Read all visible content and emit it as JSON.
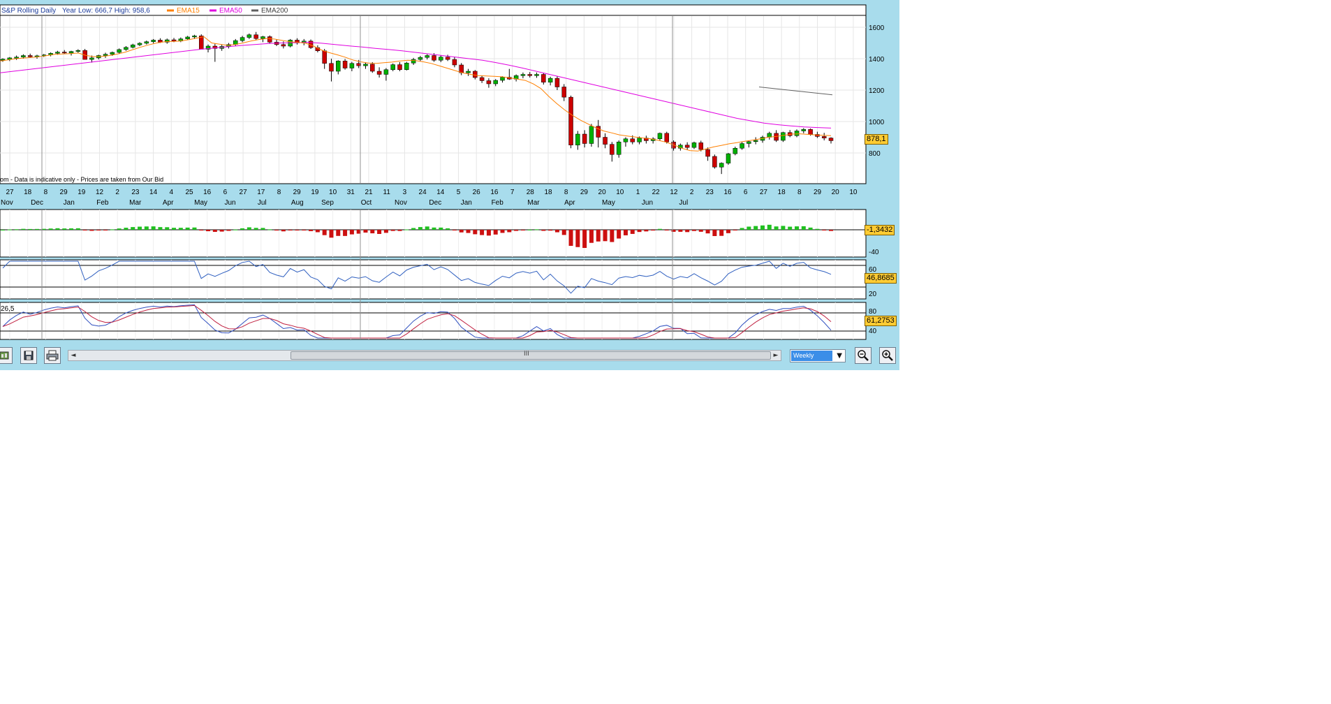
{
  "header": {
    "instrument": "S&P Rolling Daily",
    "year_range": "Year Low: 666,7 High: 958,6",
    "disclaimer": "om - Data is indicative only - Prices are taken from Our Bid"
  },
  "legend": [
    {
      "name": "EMA15",
      "color": "#ff8000"
    },
    {
      "name": "EMA50",
      "color": "#e000e0"
    },
    {
      "name": "EMA200",
      "color": "#606060"
    }
  ],
  "colors": {
    "up": "#00b000",
    "down": "#cc0000",
    "frame": "#a8dcec",
    "panel": "#ffffff",
    "grid": "#e6e6e6"
  },
  "price_axis": {
    "ticks": [
      "1600",
      "1400",
      "1200",
      "1000",
      "800"
    ]
  },
  "date_axis": {
    "days": [
      "27",
      "18",
      "8",
      "29",
      "19",
      "12",
      "2",
      "23",
      "14",
      "4",
      "25",
      "16",
      "6",
      "27",
      "17",
      "8",
      "29",
      "19",
      "10",
      "31",
      "21",
      "11",
      "3",
      "24",
      "14",
      "5",
      "26",
      "16",
      "7",
      "28",
      "18",
      "8",
      "29",
      "20",
      "10",
      "1",
      "22",
      "12",
      "2",
      "23",
      "16",
      "6",
      "27",
      "18",
      "8",
      "29",
      "20",
      "10"
    ],
    "months": [
      "Nov",
      "Dec",
      "Jan",
      "Feb",
      "Mar",
      "Apr",
      "May",
      "Jun",
      "Jul",
      "Aug",
      "Sep",
      "Oct",
      "Nov",
      "Dec",
      "Jan",
      "Feb",
      "Mar",
      "Apr",
      "May",
      "Jun",
      "Jul"
    ]
  },
  "last_values": {
    "price": "878,1",
    "histogram": "-1,3432",
    "rsi": "46,8685",
    "stoch": "61,2753"
  },
  "histogram_panel": {
    "tick": "-40"
  },
  "rsi_panel": {
    "ticks": [
      "60",
      "20"
    ]
  },
  "stoch_panel": {
    "left_label": "26,5",
    "ticks": [
      "80",
      "40"
    ]
  },
  "toolbar": {
    "period": "Weekly",
    "scroll_grip": "III",
    "scroll_left": "◄",
    "scroll_right": "►"
  },
  "chart_data": {
    "type": "line",
    "title": "S&P Rolling Daily",
    "candles": [
      {
        "o": 1390,
        "h": 1402,
        "l": 1380,
        "c": 1397
      },
      {
        "o": 1395,
        "h": 1410,
        "l": 1385,
        "c": 1405
      },
      {
        "o": 1403,
        "h": 1420,
        "l": 1392,
        "c": 1410
      },
      {
        "o": 1410,
        "h": 1428,
        "l": 1400,
        "c": 1420
      },
      {
        "o": 1420,
        "h": 1432,
        "l": 1405,
        "c": 1412
      },
      {
        "o": 1412,
        "h": 1425,
        "l": 1400,
        "c": 1418
      },
      {
        "o": 1418,
        "h": 1430,
        "l": 1410,
        "c": 1424
      },
      {
        "o": 1424,
        "h": 1440,
        "l": 1415,
        "c": 1434
      },
      {
        "o": 1434,
        "h": 1450,
        "l": 1425,
        "c": 1442
      },
      {
        "o": 1442,
        "h": 1455,
        "l": 1430,
        "c": 1436
      },
      {
        "o": 1436,
        "h": 1450,
        "l": 1420,
        "c": 1446
      },
      {
        "o": 1446,
        "h": 1460,
        "l": 1435,
        "c": 1452
      },
      {
        "o": 1452,
        "h": 1462,
        "l": 1400,
        "c": 1395
      },
      {
        "o": 1395,
        "h": 1420,
        "l": 1375,
        "c": 1405
      },
      {
        "o": 1405,
        "h": 1425,
        "l": 1395,
        "c": 1420
      },
      {
        "o": 1420,
        "h": 1438,
        "l": 1405,
        "c": 1428
      },
      {
        "o": 1428,
        "h": 1445,
        "l": 1418,
        "c": 1440
      },
      {
        "o": 1440,
        "h": 1465,
        "l": 1430,
        "c": 1458
      },
      {
        "o": 1458,
        "h": 1480,
        "l": 1450,
        "c": 1472
      },
      {
        "o": 1472,
        "h": 1495,
        "l": 1465,
        "c": 1488
      },
      {
        "o": 1488,
        "h": 1505,
        "l": 1480,
        "c": 1498
      },
      {
        "o": 1498,
        "h": 1515,
        "l": 1490,
        "c": 1508
      },
      {
        "o": 1508,
        "h": 1525,
        "l": 1498,
        "c": 1518
      },
      {
        "o": 1518,
        "h": 1530,
        "l": 1500,
        "c": 1505
      },
      {
        "o": 1505,
        "h": 1528,
        "l": 1495,
        "c": 1520
      },
      {
        "o": 1520,
        "h": 1532,
        "l": 1505,
        "c": 1512
      },
      {
        "o": 1512,
        "h": 1535,
        "l": 1505,
        "c": 1526
      },
      {
        "o": 1526,
        "h": 1545,
        "l": 1518,
        "c": 1538
      },
      {
        "o": 1538,
        "h": 1552,
        "l": 1525,
        "c": 1545
      },
      {
        "o": 1545,
        "h": 1555,
        "l": 1470,
        "c": 1460
      },
      {
        "o": 1460,
        "h": 1490,
        "l": 1440,
        "c": 1480
      },
      {
        "o": 1480,
        "h": 1495,
        "l": 1380,
        "c": 1465
      },
      {
        "o": 1465,
        "h": 1490,
        "l": 1450,
        "c": 1478
      },
      {
        "o": 1478,
        "h": 1500,
        "l": 1465,
        "c": 1490
      },
      {
        "o": 1490,
        "h": 1525,
        "l": 1480,
        "c": 1515
      },
      {
        "o": 1515,
        "h": 1545,
        "l": 1505,
        "c": 1535
      },
      {
        "o": 1535,
        "h": 1560,
        "l": 1525,
        "c": 1552
      },
      {
        "o": 1552,
        "h": 1570,
        "l": 1520,
        "c": 1528
      },
      {
        "o": 1528,
        "h": 1545,
        "l": 1505,
        "c": 1540
      },
      {
        "o": 1540,
        "h": 1548,
        "l": 1495,
        "c": 1505
      },
      {
        "o": 1505,
        "h": 1520,
        "l": 1480,
        "c": 1490
      },
      {
        "o": 1490,
        "h": 1510,
        "l": 1465,
        "c": 1480
      },
      {
        "o": 1480,
        "h": 1525,
        "l": 1472,
        "c": 1518
      },
      {
        "o": 1518,
        "h": 1530,
        "l": 1490,
        "c": 1500
      },
      {
        "o": 1500,
        "h": 1525,
        "l": 1485,
        "c": 1512
      },
      {
        "o": 1512,
        "h": 1522,
        "l": 1462,
        "c": 1470
      },
      {
        "o": 1470,
        "h": 1485,
        "l": 1440,
        "c": 1450
      },
      {
        "o": 1450,
        "h": 1462,
        "l": 1335,
        "c": 1370
      },
      {
        "o": 1370,
        "h": 1400,
        "l": 1255,
        "c": 1320
      },
      {
        "o": 1320,
        "h": 1390,
        "l": 1300,
        "c": 1385
      },
      {
        "o": 1385,
        "h": 1398,
        "l": 1330,
        "c": 1340
      },
      {
        "o": 1340,
        "h": 1380,
        "l": 1320,
        "c": 1370
      },
      {
        "o": 1370,
        "h": 1392,
        "l": 1340,
        "c": 1355
      },
      {
        "o": 1355,
        "h": 1375,
        "l": 1335,
        "c": 1365
      },
      {
        "o": 1365,
        "h": 1378,
        "l": 1310,
        "c": 1320
      },
      {
        "o": 1320,
        "h": 1345,
        "l": 1280,
        "c": 1300
      },
      {
        "o": 1300,
        "h": 1340,
        "l": 1260,
        "c": 1330
      },
      {
        "o": 1330,
        "h": 1370,
        "l": 1320,
        "c": 1362
      },
      {
        "o": 1362,
        "h": 1378,
        "l": 1320,
        "c": 1330
      },
      {
        "o": 1330,
        "h": 1380,
        "l": 1325,
        "c": 1372
      },
      {
        "o": 1372,
        "h": 1405,
        "l": 1360,
        "c": 1395
      },
      {
        "o": 1395,
        "h": 1418,
        "l": 1385,
        "c": 1408
      },
      {
        "o": 1408,
        "h": 1428,
        "l": 1395,
        "c": 1420
      },
      {
        "o": 1420,
        "h": 1435,
        "l": 1380,
        "c": 1390
      },
      {
        "o": 1390,
        "h": 1420,
        "l": 1378,
        "c": 1410
      },
      {
        "o": 1410,
        "h": 1425,
        "l": 1385,
        "c": 1395
      },
      {
        "o": 1395,
        "h": 1410,
        "l": 1345,
        "c": 1360
      },
      {
        "o": 1360,
        "h": 1372,
        "l": 1295,
        "c": 1310
      },
      {
        "o": 1310,
        "h": 1335,
        "l": 1290,
        "c": 1320
      },
      {
        "o": 1320,
        "h": 1328,
        "l": 1268,
        "c": 1280
      },
      {
        "o": 1280,
        "h": 1292,
        "l": 1245,
        "c": 1260
      },
      {
        "o": 1260,
        "h": 1275,
        "l": 1215,
        "c": 1240
      },
      {
        "o": 1240,
        "h": 1270,
        "l": 1225,
        "c": 1262
      },
      {
        "o": 1262,
        "h": 1288,
        "l": 1248,
        "c": 1282
      },
      {
        "o": 1282,
        "h": 1335,
        "l": 1265,
        "c": 1270
      },
      {
        "o": 1270,
        "h": 1300,
        "l": 1255,
        "c": 1292
      },
      {
        "o": 1292,
        "h": 1312,
        "l": 1275,
        "c": 1300
      },
      {
        "o": 1300,
        "h": 1315,
        "l": 1280,
        "c": 1292
      },
      {
        "o": 1292,
        "h": 1312,
        "l": 1278,
        "c": 1300
      },
      {
        "o": 1300,
        "h": 1310,
        "l": 1235,
        "c": 1250
      },
      {
        "o": 1250,
        "h": 1285,
        "l": 1230,
        "c": 1275
      },
      {
        "o": 1275,
        "h": 1288,
        "l": 1200,
        "c": 1220
      },
      {
        "o": 1220,
        "h": 1238,
        "l": 1130,
        "c": 1155
      },
      {
        "o": 1155,
        "h": 1165,
        "l": 830,
        "c": 850
      },
      {
        "o": 850,
        "h": 940,
        "l": 820,
        "c": 920
      },
      {
        "o": 920,
        "h": 945,
        "l": 835,
        "c": 860
      },
      {
        "o": 860,
        "h": 985,
        "l": 840,
        "c": 970
      },
      {
        "o": 970,
        "h": 1010,
        "l": 835,
        "c": 900
      },
      {
        "o": 900,
        "h": 925,
        "l": 830,
        "c": 855
      },
      {
        "o": 855,
        "h": 870,
        "l": 745,
        "c": 790
      },
      {
        "o": 790,
        "h": 880,
        "l": 770,
        "c": 870
      },
      {
        "o": 870,
        "h": 900,
        "l": 840,
        "c": 890
      },
      {
        "o": 890,
        "h": 912,
        "l": 855,
        "c": 870
      },
      {
        "o": 870,
        "h": 905,
        "l": 855,
        "c": 895
      },
      {
        "o": 895,
        "h": 910,
        "l": 860,
        "c": 878
      },
      {
        "o": 878,
        "h": 900,
        "l": 860,
        "c": 890
      },
      {
        "o": 890,
        "h": 930,
        "l": 880,
        "c": 925
      },
      {
        "o": 925,
        "h": 935,
        "l": 860,
        "c": 870
      },
      {
        "o": 870,
        "h": 880,
        "l": 815,
        "c": 830
      },
      {
        "o": 830,
        "h": 860,
        "l": 815,
        "c": 850
      },
      {
        "o": 850,
        "h": 868,
        "l": 820,
        "c": 835
      },
      {
        "o": 835,
        "h": 872,
        "l": 825,
        "c": 865
      },
      {
        "o": 865,
        "h": 878,
        "l": 810,
        "c": 822
      },
      {
        "o": 822,
        "h": 835,
        "l": 750,
        "c": 778
      },
      {
        "o": 778,
        "h": 790,
        "l": 700,
        "c": 710
      },
      {
        "o": 710,
        "h": 740,
        "l": 666,
        "c": 735
      },
      {
        "o": 735,
        "h": 800,
        "l": 725,
        "c": 795
      },
      {
        "o": 795,
        "h": 840,
        "l": 785,
        "c": 830
      },
      {
        "o": 830,
        "h": 870,
        "l": 820,
        "c": 860
      },
      {
        "o": 860,
        "h": 880,
        "l": 835,
        "c": 872
      },
      {
        "o": 872,
        "h": 900,
        "l": 855,
        "c": 880
      },
      {
        "o": 880,
        "h": 910,
        "l": 865,
        "c": 900
      },
      {
        "o": 900,
        "h": 935,
        "l": 885,
        "c": 925
      },
      {
        "o": 925,
        "h": 945,
        "l": 870,
        "c": 880
      },
      {
        "o": 880,
        "h": 935,
        "l": 870,
        "c": 930
      },
      {
        "o": 930,
        "h": 946,
        "l": 900,
        "c": 910
      },
      {
        "o": 910,
        "h": 950,
        "l": 900,
        "c": 940
      },
      {
        "o": 940,
        "h": 958,
        "l": 925,
        "c": 950
      },
      {
        "o": 950,
        "h": 956,
        "l": 910,
        "c": 918
      },
      {
        "o": 918,
        "h": 935,
        "l": 895,
        "c": 905
      },
      {
        "o": 905,
        "h": 928,
        "l": 880,
        "c": 895
      },
      {
        "o": 895,
        "h": 900,
        "l": 860,
        "c": 878
      }
    ],
    "ema15": [
      1385,
      1392,
      1400,
      1404,
      1408,
      1412,
      1420,
      1428,
      1430,
      1432,
      1436,
      1420,
      1413,
      1414,
      1420,
      1430,
      1442,
      1458,
      1474,
      1488,
      1500,
      1508,
      1510,
      1512,
      1520,
      1530,
      1540,
      1500,
      1492,
      1485,
      1490,
      1500,
      1512,
      1522,
      1528,
      1525,
      1516,
      1508,
      1504,
      1498,
      1480,
      1455,
      1438,
      1425,
      1410,
      1392,
      1380,
      1372,
      1370,
      1374,
      1378,
      1385,
      1390,
      1388,
      1380,
      1370,
      1355,
      1340,
      1325,
      1310,
      1300,
      1292,
      1290,
      1288,
      1285,
      1278,
      1270,
      1262,
      1240,
      1210,
      1160,
      1115,
      1075,
      1040,
      1010,
      985,
      960,
      940,
      928,
      915,
      908,
      902,
      895,
      890,
      880,
      868,
      850,
      830,
      815,
      812,
      825,
      838,
      848,
      858,
      866,
      874,
      882,
      890,
      900,
      905,
      912,
      920,
      922,
      918,
      915,
      912,
      910
    ],
    "ema15_x": [
      0,
      10,
      20,
      30,
      40,
      50,
      60,
      70,
      80,
      90,
      100,
      110,
      120,
      130,
      140,
      150,
      160,
      170,
      180,
      190,
      200,
      210,
      220,
      230,
      240,
      250,
      260,
      270,
      280,
      290,
      300,
      310,
      320,
      330,
      340,
      350,
      360,
      370,
      380,
      390,
      400,
      410,
      420,
      430,
      440,
      450,
      460,
      470,
      480,
      490,
      500,
      510,
      520,
      530,
      540,
      550,
      560,
      570,
      580,
      590,
      600,
      610,
      620,
      630,
      640,
      650,
      660,
      670,
      680,
      690,
      700,
      710,
      720,
      730,
      740,
      750,
      760,
      770,
      780,
      790,
      800,
      810,
      820,
      830,
      840,
      850,
      860,
      870,
      880,
      890,
      900,
      910,
      920,
      930,
      940,
      950,
      960,
      970,
      980,
      990,
      1000,
      1010,
      1020,
      1030,
      1040,
      1050,
      1060
    ],
    "ema50": [
      1310,
      1320,
      1330,
      1340,
      1350,
      1360,
      1370,
      1380,
      1390,
      1400,
      1410,
      1420,
      1430,
      1440,
      1450,
      1460,
      1468,
      1476,
      1484,
      1490,
      1496,
      1500,
      1502,
      1504,
      1498,
      1490,
      1482,
      1474,
      1466,
      1458,
      1450,
      1440,
      1430,
      1420,
      1410,
      1400,
      1390,
      1375,
      1358,
      1340,
      1320,
      1300,
      1280,
      1260,
      1240,
      1220,
      1200,
      1180,
      1160,
      1140,
      1120,
      1100,
      1080,
      1060,
      1040,
      1020,
      1005,
      990,
      980,
      972,
      966,
      962,
      958
    ],
    "ema50_x": [
      0,
      20,
      40,
      60,
      80,
      100,
      120,
      140,
      160,
      180,
      200,
      220,
      240,
      260,
      280,
      300,
      320,
      340,
      360,
      380,
      400,
      420,
      440,
      460,
      480,
      500,
      520,
      540,
      560,
      580,
      600,
      620,
      640,
      660,
      680,
      700,
      720,
      740,
      760,
      780,
      800,
      820,
      840,
      860,
      880,
      900,
      920,
      940,
      960,
      980,
      1000,
      1020,
      1040,
      1060,
      1080,
      1100,
      1120,
      1140,
      1160,
      1180,
      1200,
      1220,
      1240
    ],
    "ema200": [
      1220,
      1210,
      1200,
      1190,
      1180,
      1170
    ]
  }
}
